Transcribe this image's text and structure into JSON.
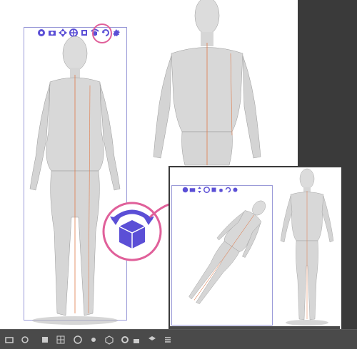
{
  "colors": {
    "background_dark": "#3a3a3a",
    "canvas": "#ffffff",
    "bounding_box": "#9a9ad8",
    "tool_icon": "#5b4fd6",
    "highlight_circle": "#e0609a",
    "model_skin": "#d8d8d8",
    "guide_line": "#e07a4a"
  },
  "main_toolbar": {
    "icons": [
      "rotate-icon",
      "move-camera-icon",
      "pan-icon",
      "move-icon",
      "scale-icon",
      "rotate-object-icon",
      "reset-icon",
      "settings-icon"
    ],
    "highlighted_icon": "rotate-object-icon"
  },
  "inset_toolbar": {
    "icons": [
      "rotate-icon",
      "move-camera-icon",
      "pan-icon",
      "move-icon",
      "scale-icon",
      "rotate-object-icon",
      "reset-icon",
      "settings-icon"
    ]
  },
  "callout": {
    "icon": "rotate-object-icon-enlarged"
  },
  "bottom_toolbar": {
    "icons": [
      "view-icon",
      "camera-icon",
      "light-icon",
      "grid-icon",
      "pose-icon",
      "hand-icon",
      "object-icon",
      "settings-icon",
      "lock-icon",
      "layer-icon",
      "menu-icon"
    ]
  }
}
